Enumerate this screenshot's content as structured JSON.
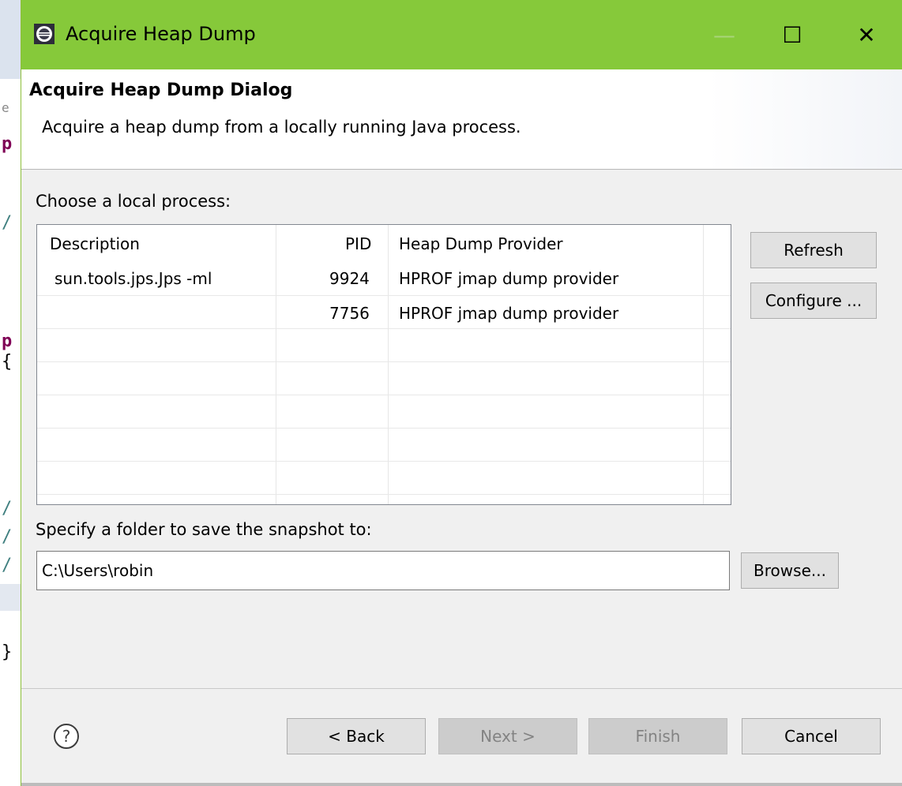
{
  "window": {
    "title": "Acquire Heap Dump",
    "controls": {
      "minimize": "—",
      "maximize": "☐",
      "close": "✕"
    }
  },
  "banner": {
    "title": "Acquire Heap Dump Dialog",
    "description": "Acquire a heap dump from a locally running Java process."
  },
  "process_section": {
    "label": "Choose a local process:",
    "columns": [
      "Description",
      "PID",
      "Heap Dump Provider"
    ],
    "rows": [
      {
        "description": "sun.tools.jps.Jps -ml",
        "pid": "9924",
        "provider": "HPROF jmap dump provider"
      },
      {
        "description": "",
        "pid": "7756",
        "provider": "HPROF jmap dump provider"
      }
    ],
    "refresh_label": "Refresh",
    "configure_label": "Configure ..."
  },
  "folder_section": {
    "label": "Specify a folder to save the snapshot to:",
    "value": "C:\\Users\\robin",
    "browse_label": "Browse..."
  },
  "footer": {
    "help_icon": "question-circle-icon",
    "back_label": "< Back",
    "next_label": "Next >",
    "finish_label": "Finish",
    "cancel_label": "Cancel"
  },
  "background_editor": {
    "glyphs": [
      "e",
      "p",
      "/",
      "p",
      "{",
      "/",
      "/",
      "/",
      "}"
    ]
  },
  "colors": {
    "titlebar": "#86c93a",
    "dialog_bg": "#f0f0f0",
    "button_bg": "#e1e1e1",
    "disabled_text": "#838383"
  }
}
